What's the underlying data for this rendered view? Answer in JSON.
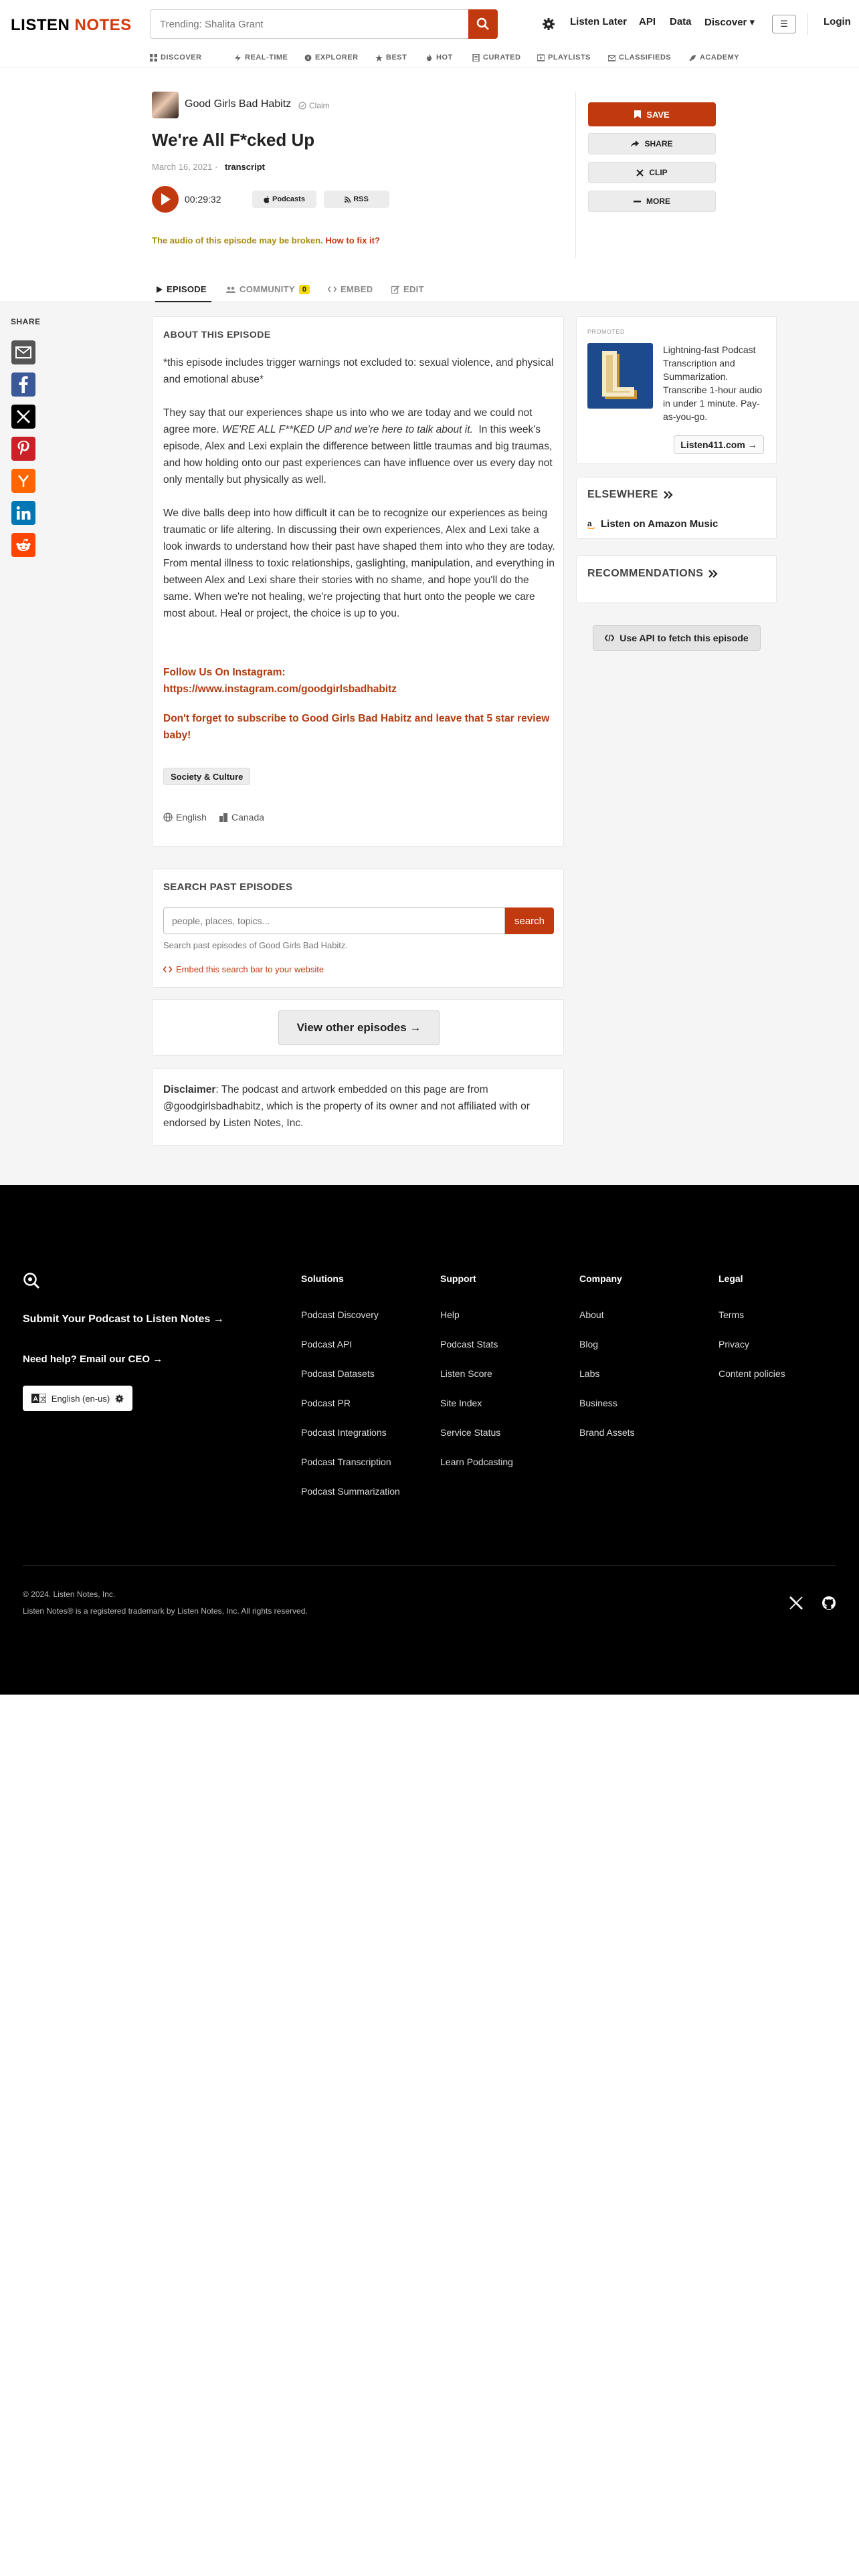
{
  "header": {
    "logo_part1": "LISTEN",
    "logo_part2": "NOTES",
    "search_placeholder": "Trending: Shalita Grant",
    "nav": [
      "Listen Later",
      "API",
      "Data",
      "Discover ▾",
      "Login"
    ],
    "menu_glyph": "☰"
  },
  "subnav": [
    "DISCOVER",
    "REAL-TIME",
    "EXPLORER",
    "BEST",
    "HOT",
    "CURATED",
    "PLAYLISTS",
    "CLASSIFIEDS",
    "ACADEMY"
  ],
  "episode": {
    "podcast_name": "Good Girls Bad Habitz",
    "claim": "Claim",
    "title": "We're All F*cked Up",
    "date": "March 16, 2021 ·",
    "transcript": "transcript",
    "duration": "00:29:32",
    "podcasts_pill": "Podcasts",
    "rss_pill": "RSS",
    "broken_text": "The audio of this episode may be broken.",
    "fix_link": "How to fix it?"
  },
  "actions": {
    "save": "SAVE",
    "share": "SHARE",
    "clip": "CLIP",
    "more": "MORE"
  },
  "tabs": {
    "episode": "EPISODE",
    "community": "COMMUNITY",
    "community_count": "0",
    "embed": "EMBED",
    "edit": "EDIT"
  },
  "share": {
    "title": "SHARE",
    "icons": [
      "email-icon",
      "facebook-icon",
      "x-icon",
      "pinterest-icon",
      "hacker-news-icon",
      "linkedin-icon",
      "reddit-icon"
    ],
    "colors": [
      "#555555",
      "#3b5998",
      "#000000",
      "#cb2027",
      "#ff6600",
      "#0077b5",
      "#ff4500"
    ]
  },
  "about": {
    "title": "ABOUT THIS EPISODE",
    "p1": "*this episode includes trigger warnings not excluded to: sexual violence, and physical and emotional abuse*",
    "p2a": "They say that our experiences shape us into who we are today and we could not agree more.",
    "p2b": "WE'RE ALL F**KED UP and we're here to talk about it.",
    "p2c": "In this week's episode, Alex and Lexi explain the difference between little traumas and big traumas, and how holding onto our past experiences can have influence over us every day not only mentally but physically as well.",
    "p3": "We dive balls deep into how difficult it can be to recognize our experiences as being traumatic or life altering. In discussing their own experiences, Alex and Lexi take a look inwards to understand how their past have shaped them into who they are today. From mental illness to toxic relationships, gaslighting, manipulation, and everything in between Alex and Lexi share their stories with no shame, and hope you'll do the same. When we're not healing, we're projecting that hurt onto the people we care most about. Heal or project, the choice is up to you.",
    "follow": "Follow Us On Instagram:",
    "ig_link": "https://www.instagram.com/goodgirlsbadhabitz",
    "subscribe": "Don't forget to subscribe to Good Girls Bad Habitz and leave that 5 star review baby!",
    "tag": "Society & Culture",
    "language": "English",
    "country": "Canada"
  },
  "search_past": {
    "title": "SEARCH PAST EPISODES",
    "placeholder": "people, places, topics...",
    "button": "search",
    "help": "Search past episodes of Good Girls Bad Habitz.",
    "embed": "Embed this search bar to your website"
  },
  "view_other": "View other episodes →",
  "disclaimer": {
    "label": "Disclaimer",
    "text": ": The podcast and artwork embedded on this page are from @goodgirlsbadhabitz, which is the property of its owner and not affiliated with or endorsed by Listen Notes, Inc."
  },
  "sidebar": {
    "promoted": "PROMOTED",
    "promo_text": "Lightning-fast Podcast Transcription and Summarization. Transcribe 1-hour audio in under 1 minute. Pay-as-you-go.",
    "promo_button": "Listen411.com →",
    "elsewhere": "ELSEWHERE",
    "amazon": "Listen on Amazon Music",
    "recommendations": "RECOMMENDATIONS",
    "api_button": "Use API to fetch this episode"
  },
  "footer": {
    "submit": "Submit Your Podcast to Listen Notes →",
    "help": "Need help? Email our CEO →",
    "language": "English (en-us)",
    "columns": [
      {
        "title": "Solutions",
        "links": [
          "Podcast Discovery",
          "Podcast API",
          "Podcast Datasets",
          "Podcast PR",
          "Podcast Integrations",
          "Podcast Transcription",
          "Podcast Summarization"
        ]
      },
      {
        "title": "Support",
        "links": [
          "Help",
          "Podcast Stats",
          "Listen Score",
          "Site Index",
          "Service Status",
          "Learn Podcasting"
        ]
      },
      {
        "title": "Company",
        "links": [
          "About",
          "Blog",
          "Labs",
          "Business",
          "Brand Assets"
        ]
      },
      {
        "title": "Legal",
        "links": [
          "Terms",
          "Privacy",
          "Content policies"
        ]
      }
    ],
    "copyright": "© 2024. Listen Notes, Inc.",
    "trademark": "Listen Notes® is a registered trademark by Listen Notes, Inc. All rights reserved."
  }
}
